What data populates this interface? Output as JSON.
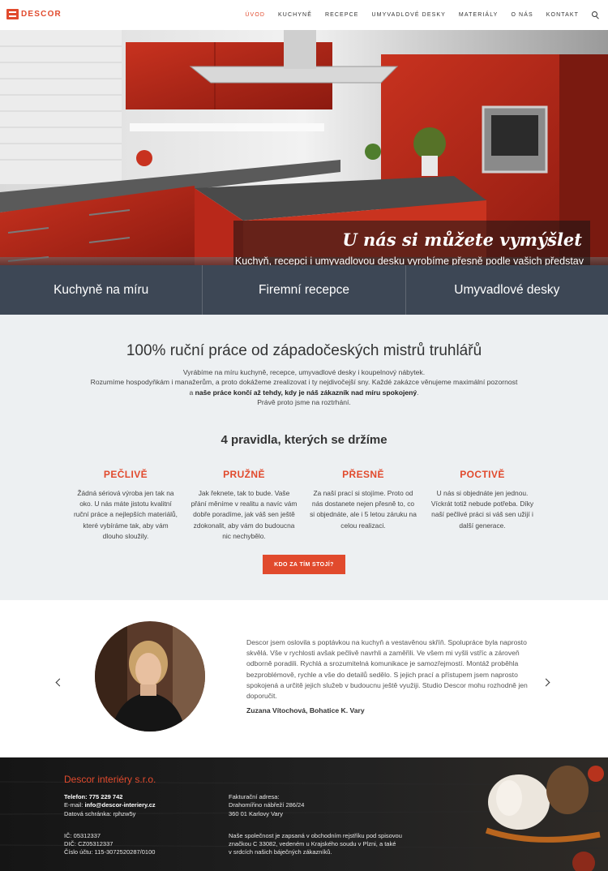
{
  "header": {
    "logo_text": "DESCOR",
    "nav": [
      "Úvod",
      "Kuchyně",
      "Recepce",
      "Umyvadlové desky",
      "Materiály",
      "O nás",
      "Kontakt"
    ],
    "active": "Úvod"
  },
  "hero": {
    "title": "U nás si můžete vymýšlet",
    "subtitle": "Kuchyň, recepci i umyvadlovou desku vyrobíme přesně podle vašich představ"
  },
  "services": [
    "Kuchyně na míru",
    "Firemní recepce",
    "Umyvadlové desky"
  ],
  "intro": {
    "title": "100% ruční práce od západočeských mistrů truhlářů",
    "line1": "Vyrábíme na míru kuchyně, recepce, umyvadlové desky i koupelnový nábytek.",
    "line2": "Rozumíme hospodyňkám i manažerům, a proto dokážeme zrealizovat i ty nejdivočejší sny. Každé zakázce věnujeme maximální pozornost",
    "line3_pre": "a ",
    "line3_bold": "naše práce končí až tehdy, kdy je náš zákazník nad míru spokojený",
    "line3_post": ".",
    "line4": "Právě proto jsme na roztrhání."
  },
  "rules": {
    "title": "4 pravidla, kterých se držíme",
    "items": [
      {
        "title": "PEČLIVĚ",
        "text": "Žádná sériová výroba jen tak na oko. U nás máte jistotu kvalitní ruční práce a nejlepších materiálů, které vybíráme tak, aby vám dlouho sloužily."
      },
      {
        "title": "PRUŽNĚ",
        "text": "Jak řeknete, tak to bude. Vaše přání měníme v realitu a navíc vám dobře poradíme, jak váš sen ještě zdokonalit, aby vám do budoucna nic nechybělo."
      },
      {
        "title": "PŘESNĚ",
        "text": "Za naší prací si stojíme. Proto od nás dostanete nejen přesně to, co si objednáte, ale i 5 letou záruku na celou realizaci."
      },
      {
        "title": "POCTIVĚ",
        "text": "U nás si objednáte jen jednou. Víckrát totiž nebude potřeba. Díky naší pečlivé práci si váš sen užijí i další generace."
      }
    ],
    "cta": "KDO ZA TÍM STOJÍ?"
  },
  "testimonial": {
    "quote": "Descor jsem oslovila s poptávkou na kuchyň a vestavěnou skříň. Spolupráce byla naprosto skvělá. Vše v rychlosti avšak pečlivě navrhli a zaměřili. Ve všem mi vyšli vstříc a zároveň odborně poradili. Rychlá a srozumitelná komunikace je samozřejmostí. Montáž proběhla bezproblémově, rychle a vše do detailů sedělo. S jejich prací a přístupem jsem naprosto spokojená a určitě jejich služeb v budoucnu ještě využiji. Studio Descor mohu rozhodně jen doporučit.",
    "author": "Zuzana Vítochová, Bohatice K. Vary"
  },
  "footer": {
    "title": "Descor interiéry s.r.o.",
    "phone_label": "Telefon:",
    "phone": "775 229 742",
    "email_label": "E-mail:",
    "email": "info@descor-interiery.cz",
    "databox": "Datová schránka: rphzw5y",
    "ic": "IČ: 05312337",
    "dic": "DIČ: CZ05312337",
    "account": "Číslo účtu: 115-3072520287/0100",
    "billing_label": "Fakturační adresa:",
    "street": "Drahomířino nábřeží 286/24",
    "city": "360 01 Karlovy Vary",
    "register1": "Naše společnost je zapsaná v obchodním rejstříku pod spisovou",
    "register2": "značkou C 33082, vedeném u Krajského soudu v Plzni, a také",
    "register3": "v srdcích našich báječných zákazníků."
  },
  "colors": {
    "accent": "#e14a2d",
    "service_bar": "#3d4755",
    "intro_bg": "#edf0f2",
    "footer_bg": "#1a1a1a"
  }
}
